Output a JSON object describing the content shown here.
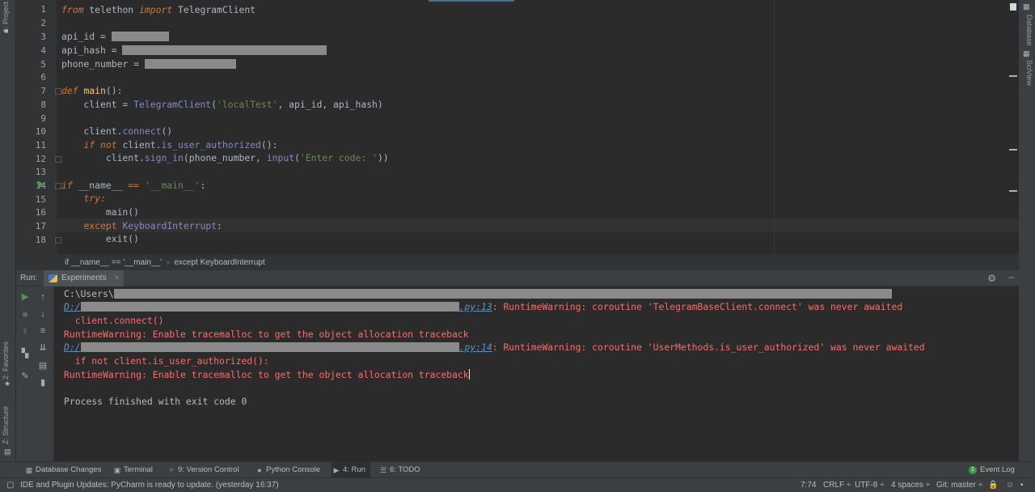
{
  "left_strip": {
    "project_tab": "1: Project",
    "favorites_tab": "2: Favorites",
    "structure_tab": "Z: Structure"
  },
  "right_strip": {
    "database_tab": "Database",
    "sciview_tab": "SciView"
  },
  "editor": {
    "line_numbers": [
      "1",
      "2",
      "3",
      "4",
      "5",
      "6",
      "7",
      "8",
      "9",
      "10",
      "11",
      "12",
      "13",
      "14",
      "15",
      "16",
      "17",
      "18"
    ],
    "code": {
      "l1_from": "from",
      "l1_mod": " telethon ",
      "l1_import": "import",
      "l1_cls": " TelegramClient",
      "l3": "api_id = ",
      "l4": "api_hash = ",
      "l5": "phone_number = ",
      "l7_def": "def",
      "l7_fn": "main",
      "l7_rest": "():",
      "l8_a": "    client = ",
      "l8_cls": "TelegramClient",
      "l8_b": "(",
      "l8_str": "'localTest'",
      "l8_c": ", api_id, api_hash)",
      "l10_a": "    client.",
      "l10_m": "connect",
      "l10_b": "()",
      "l11_if": "if",
      "l11_not": "not",
      "l11_a": " client.",
      "l11_m": "is_user_authorized",
      "l11_b": "():",
      "l12_a": "        client.",
      "l12_m": "sign_in",
      "l12_b": "(phone_number, ",
      "l12_in": "input",
      "l12_c": "(",
      "l12_str": "'Enter code: '",
      "l12_d": "))",
      "l14_if": "if",
      "l14_a": " __name__ ",
      "l14_op": "==",
      "l14_sp": " ",
      "l14_str": "'__main__'",
      "l14_b": ":",
      "l15_try": "try:",
      "l16": "        main()",
      "l17_exc": "except",
      "l17_a": " KeyboardInterrupt",
      "l17_b": ":",
      "l18": "        exit()"
    }
  },
  "breadcrumb": {
    "item1": "if __name__ == '__main__'",
    "item2": "except KeyboardInterrupt"
  },
  "run_window": {
    "label": "Run:",
    "tab": "Experiments"
  },
  "console": {
    "line1": "C:\\Users\\",
    "line2_link_prefix": "D:/",
    "line2_link_suffix": ".py:13",
    "line2_rest": ": RuntimeWarning: coroutine 'TelegramBaseClient.connect' was never awaited",
    "line3": "  client.connect()",
    "line4": "RuntimeWarning: Enable tracemalloc to get the object allocation traceback",
    "line5_link_prefix": "D:/",
    "line5_link_suffix": ".py:14",
    "line5_rest": ": RuntimeWarning: coroutine 'UserMethods.is_user_authorized' was never awaited",
    "line6": "  if not client.is_user_authorized():",
    "line7": "RuntimeWarning: Enable tracemalloc to get the object allocation traceback",
    "line9": "Process finished with exit code 0"
  },
  "bottom_tools": {
    "db_changes": "Database Changes",
    "terminal": "Terminal",
    "vcs": "9: Version Control",
    "python_console": "Python Console",
    "run": "4: Run",
    "todo": "6: TODO",
    "event_log": "Event Log",
    "event_count": "1"
  },
  "status": {
    "message": "IDE and Plugin Updates: PyCharm is ready to update. (yesterday 16:37)",
    "position": "7:74",
    "line_sep": "CRLF ÷",
    "encoding": "UTF-8 ÷",
    "indent": "4 spaces ÷",
    "git": "Git: master ÷"
  }
}
